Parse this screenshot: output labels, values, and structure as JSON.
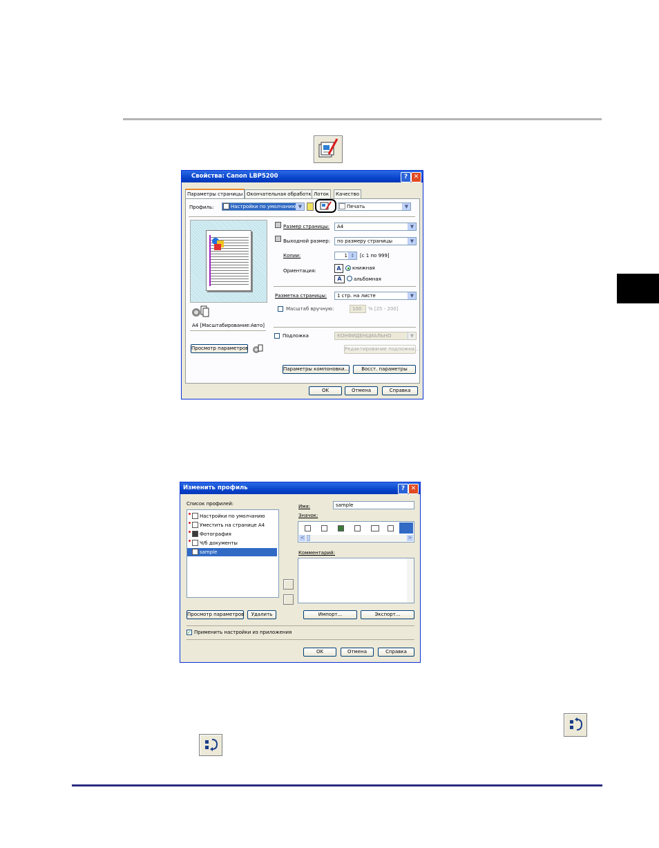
{
  "dialog1": {
    "title": "Свойства: Canon LBP5200",
    "help_btn": "?",
    "close_btn": "✕",
    "tabs": [
      "Параметры страницы",
      "Окончательная обработка",
      "Лоток",
      "Качество"
    ],
    "profile_label": "Профиль:",
    "profile_value": "Настройки по умолчанию",
    "output_label": "Печать",
    "page_size_label": "Размер страницы:",
    "page_size_value": "A4",
    "output_size_label": "Выходной размер:",
    "output_size_value": "по размеру страницы",
    "copies_label": "Копии:",
    "copies_value": "1",
    "copies_range": "[с 1 по 999]",
    "orientation_label": "Ориентация:",
    "portrait_label": "книжная",
    "landscape_label": "альбомная",
    "layout_label": "Разметка страницы:",
    "layout_value": "1 стр. на листе",
    "manual_scale_label": "Масштаб вручную:",
    "scale_value": "100",
    "scale_range": "% [25 - 200]",
    "preview_caption": "A4 [Масштабирование:Авто]",
    "watermark_label": "Подложка",
    "watermark_value": "КОНФИДЕНЦИАЛЬНО",
    "edit_watermark_btn": "Редактирование подложки...",
    "view_settings_btn": "Просмотр параметров",
    "layout_options_btn": "Параметры компоновки...",
    "restore_btn": "Восст. параметры",
    "ok_btn": "OK",
    "cancel_btn": "Отмена",
    "help_text_btn": "Справка"
  },
  "dialog2": {
    "title": "Изменить профиль",
    "help_btn": "?",
    "close_btn": "✕",
    "list_label": "Список профилей:",
    "profiles": [
      "Настройки по умолчанию",
      "Уместить на странице A4",
      "Фотография",
      "Ч/б документы",
      "sample"
    ],
    "name_label": "Имя:",
    "name_value": "sample",
    "icon_label": "Значок:",
    "comment_label": "Комментарий:",
    "view_settings_btn": "Просмотр параметров",
    "delete_btn": "Удалить",
    "import_btn": "Импорт...",
    "export_btn": "Экспорт...",
    "apply_label": "Применить настройки из приложения",
    "ok_btn": "OK",
    "cancel_btn": "Отмена",
    "help_text_btn": "Справка"
  }
}
